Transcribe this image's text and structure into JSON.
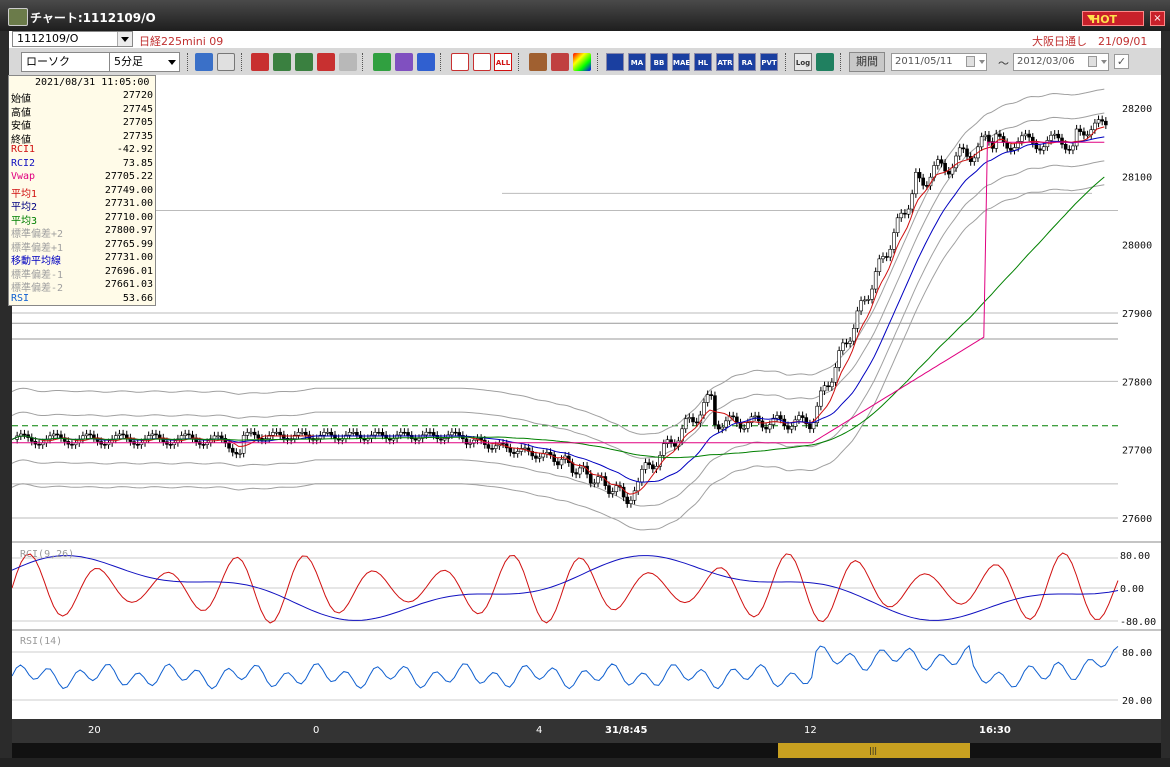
{
  "window": {
    "title": "チャート:1112109/O",
    "hot_label": "HOT",
    "close_label": "×"
  },
  "infobar": {
    "symbol_code": "1112109/O",
    "symbol_name": "日経225mini 09",
    "session": "大阪日通し　21/09/01"
  },
  "toolbar": {
    "chart_type": "ローソク",
    "interval": "5分足",
    "period_label": "期間",
    "date_from": "2011/05/11",
    "date_to": "2012/03/06",
    "tilde": "〜",
    "check": "✓",
    "indicator_buttons": [
      "MA",
      "BB",
      "MAE",
      "HL",
      "ATR",
      "RA",
      "PVT"
    ],
    "log_button": "Log",
    "all_button": "ALL"
  },
  "info_panel": {
    "datetime": "2021/08/31 11:05:00",
    "rows": [
      {
        "label": "始値",
        "value": "27720",
        "color": "#000000"
      },
      {
        "label": "高値",
        "value": "27745",
        "color": "#000000"
      },
      {
        "label": "安値",
        "value": "27705",
        "color": "#000000"
      },
      {
        "label": "終値",
        "value": "27735",
        "color": "#000000"
      },
      {
        "label": "RCI1",
        "value": "-42.92",
        "color": "#d01010"
      },
      {
        "label": "RCI2",
        "value": "73.85",
        "color": "#1010c0"
      },
      {
        "label": "Vwap",
        "value": "27705.22",
        "color": "#e00080"
      },
      {
        "label": "平均1",
        "value": "27749.00",
        "color": "#d01010"
      },
      {
        "label": "平均2",
        "value": "27731.00",
        "color": "#000080"
      },
      {
        "label": "平均3",
        "value": "27710.00",
        "color": "#008000"
      },
      {
        "label": "標準偏差+2",
        "value": "27800.97",
        "color": "#a0a0a0"
      },
      {
        "label": "標準偏差+1",
        "value": "27765.99",
        "color": "#a0a0a0"
      },
      {
        "label": "移動平均線",
        "value": "27731.00",
        "color": "#0000c0"
      },
      {
        "label": "標準偏差-1",
        "value": "27696.01",
        "color": "#a0a0a0"
      },
      {
        "label": "標準偏差-2",
        "value": "27661.03",
        "color": "#a0a0a0"
      },
      {
        "label": "RSI",
        "value": "53.66",
        "color": "#1060d0"
      }
    ]
  },
  "chart_data": [
    {
      "type": "candlestick",
      "panel": "price",
      "y_ticks": [
        "28200",
        "28100",
        "28000",
        "27900",
        "27800",
        "27700",
        "27600"
      ],
      "ylim": [
        27580,
        28220
      ],
      "reference_line": 27735,
      "x_ticks": [
        "20",
        "0",
        "4",
        "31/8:45",
        "12",
        "16:30"
      ],
      "colors": {
        "up": "#ffffff",
        "down": "#000000",
        "ma1": "#d01010",
        "ma2": "#0000c0",
        "ma3": "#008000",
        "vwap": "#e00080",
        "bands": "#a0a0a0",
        "ref": "#008000"
      }
    },
    {
      "type": "line",
      "panel": "rci",
      "title": "RCI(9,26)",
      "y_ticks": [
        "80.00",
        "0.00",
        "-80.00"
      ],
      "ylim": [
        -100,
        100
      ],
      "series": [
        {
          "color": "#d01010"
        },
        {
          "color": "#1010c0"
        }
      ]
    },
    {
      "type": "line",
      "panel": "rsi",
      "title": "RSI(14)",
      "y_ticks": [
        "80.00",
        "20.00"
      ],
      "ylim": [
        0,
        100
      ],
      "series": [
        {
          "color": "#1060d0"
        }
      ]
    }
  ]
}
